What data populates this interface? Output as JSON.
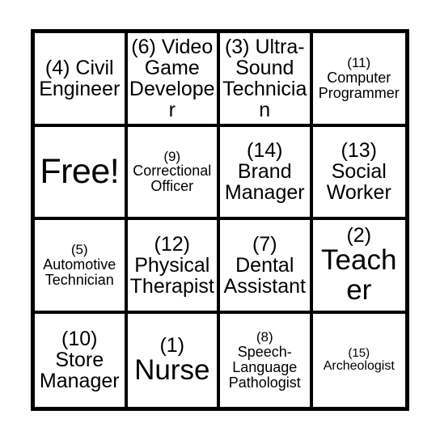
{
  "card": {
    "type": "bingo-card",
    "rows": 4,
    "columns": 4,
    "background_color": "#ffffff",
    "border_color": "#000000",
    "text_color": "#000000",
    "cells": [
      {
        "number": "(4)",
        "label": "Civil Engineer",
        "full_text": "(4) Civil Engineer",
        "free_space": false,
        "inline_number": true,
        "size": "lg"
      },
      {
        "number": "(6)",
        "label": "Video Game Developer",
        "full_text": "(6) Video Game Developer",
        "free_space": false,
        "inline_number": true,
        "size": "lg"
      },
      {
        "number": "(3)",
        "label": "Ultra-Sound Technician",
        "full_text": "(3) Ultra-Sound Technician",
        "free_space": false,
        "inline_number": true,
        "size": "lg"
      },
      {
        "number": "(11)",
        "label": "Computer Programmer",
        "full_text": "(11) Computer Programmer",
        "free_space": false,
        "inline_number": false,
        "size": "sm"
      },
      {
        "number": "",
        "label": "Free!",
        "full_text": "Free!",
        "free_space": true,
        "inline_number": false,
        "size": "free"
      },
      {
        "number": "(9)",
        "label": "Correctional Officer",
        "full_text": "(9) Correctional Officer",
        "free_space": false,
        "inline_number": false,
        "size": "sm"
      },
      {
        "number": "(14)",
        "label": "Brand Manager",
        "full_text": "(14) Brand Manager",
        "free_space": false,
        "inline_number": false,
        "size": "lg"
      },
      {
        "number": "(13)",
        "label": "Social Worker",
        "full_text": "(13) Social Worker",
        "free_space": false,
        "inline_number": false,
        "size": "lg"
      },
      {
        "number": "(5)",
        "label": "Automotive Technician",
        "full_text": "(5) Automotive Technician",
        "free_space": false,
        "inline_number": false,
        "size": "sm"
      },
      {
        "number": "(12)",
        "label": "Physical Therapist",
        "full_text": "(12) Physical Therapist",
        "free_space": false,
        "inline_number": false,
        "size": "lg"
      },
      {
        "number": "(7)",
        "label": "Dental Assistant",
        "full_text": "(7) Dental Assistant",
        "free_space": false,
        "inline_number": false,
        "size": "lg"
      },
      {
        "number": "(2)",
        "label": "Teacher",
        "full_text": "(2) Teacher",
        "free_space": false,
        "inline_number": false,
        "size": "xl"
      },
      {
        "number": "(10)",
        "label": "Store Manager",
        "full_text": "(10) Store Manager",
        "free_space": false,
        "inline_number": false,
        "size": "lg"
      },
      {
        "number": "(1)",
        "label": "Nurse",
        "full_text": "(1) Nurse",
        "free_space": false,
        "inline_number": false,
        "size": "xl"
      },
      {
        "number": "(8)",
        "label": "Speech-Language Pathologist",
        "full_text": "(8) Speech-Language Pathologist",
        "free_space": false,
        "inline_number": false,
        "size": "sm"
      },
      {
        "number": "(15)",
        "label": "Archeologist",
        "full_text": "(15) Archeologist",
        "free_space": false,
        "inline_number": false,
        "size": "xs"
      }
    ]
  }
}
